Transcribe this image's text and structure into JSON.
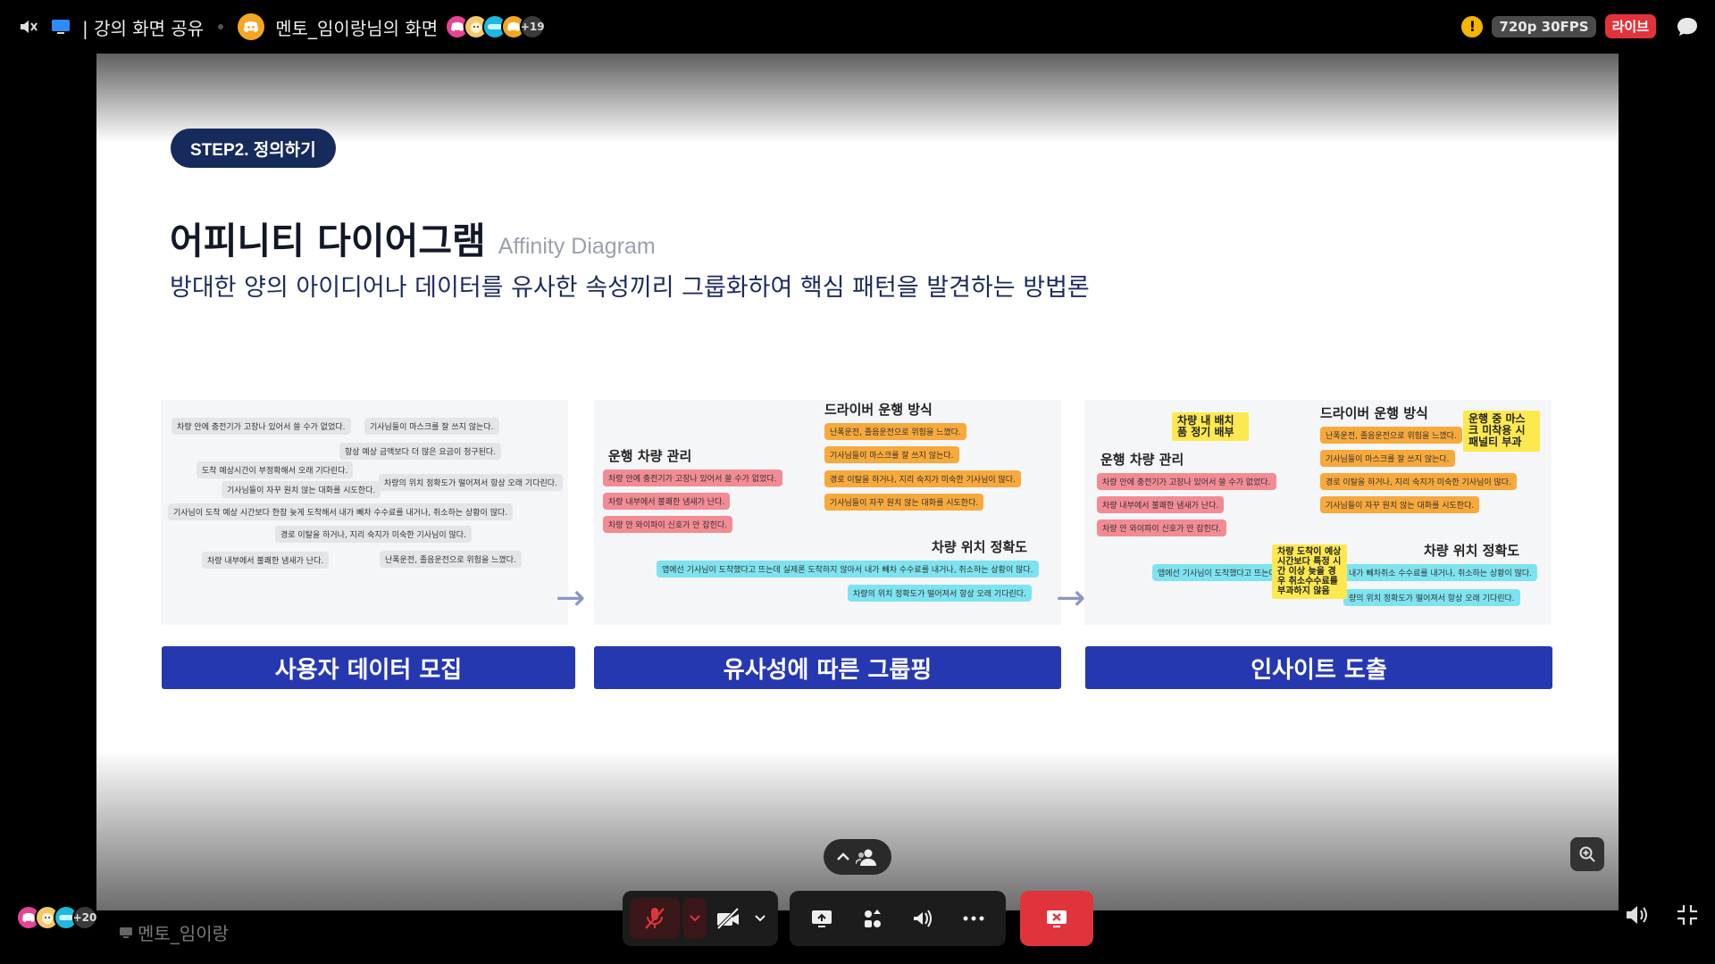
{
  "topbar": {
    "channel_label": "| 강의 화면 공유",
    "stream_title": "멘토_임이랑님의 화면",
    "viewer_more_count": "+19",
    "warning_symbol": "!",
    "quality": "720p 30FPS",
    "live_badge": "라이브"
  },
  "slide": {
    "step_badge": "STEP2. 정의하기",
    "title_ko": "어피니티 다이어그램",
    "title_en": "Affinity Diagram",
    "subtitle": "방대한 양의 아이디어나 데이터를 유사한 속성끼리 그룹화하여 핵심 패턴을 발견하는 방법론",
    "panel1_notes": [
      "차량 안에 충전기가 고장나 있어서 쓸 수가 없었다.",
      "기사님들이 마스크를 잘 쓰지 않는다.",
      "항상 예상 금액보다 더 많은 요금이 청구된다.",
      "도착 예상시간이 부정확해서 오래 기다린다.",
      "차량의 위치 정확도가 떨어져서 항상 오래 기다린다.",
      "기사님들이 자꾸 원치 않는 대화를 시도한다.",
      "기사님이 도착 예상 시간보다 한참 늦게 도착해서 내가 빼차 수수료를 내거나, 취소하는 상황이 많다.",
      "경로 이탈을 하거나, 지리 숙지가 미숙한 기사님이 많다.",
      "차량 내부에서 불쾌한 냄새가 난다.",
      "난폭운전, 졸음운전으로 위험을 느꼈다."
    ],
    "panel2": {
      "group_driver": "드라이버 운행 방식",
      "group_vehicle": "운행 차량 관리",
      "group_location": "차량 위치 정확도",
      "orange_notes": [
        "난폭운전, 졸음운전으로 위험을 느꼈다.",
        "기사님들이 마스크를 잘 쓰지 않는다.",
        "경로 이탈을 하거나, 지리 숙지가 미숙한 기사님이 많다.",
        "기사님들이 자꾸 원치 않는 대화를 시도한다."
      ],
      "pink_notes": [
        "차량 안에 충전기가 고장나 있어서 쓸 수가 없었다.",
        "차량 내부에서 불쾌한 냄새가 난다.",
        "차량 안 와이파이 신호가 안 잡힌다."
      ],
      "cyan_notes": [
        "앱에선 기사님이 도착했다고 뜨는데 실제론 도착하지 않아서 내가 빼차 수수료를 내거나, 취소하는 상황이 많다.",
        "차량의 위치 정확도가 떨어져서 항상 오래 기다린다."
      ]
    },
    "panel3": {
      "group_driver": "드라이버 운행 방식",
      "group_vehicle": "운행 차량 관리",
      "group_location": "차량 위치 정확도",
      "insight_vehicle": "차량 내 배치품 정기 배부",
      "insight_mask": "운행 중 마스크 미착용 시 패널티 부과",
      "insight_eta": "차량 도착이 예상 시간보다 특정 시간 이상 늦을 경우 취소수수료를 부과하지 않음",
      "orange_notes": [
        "난폭운전, 졸음운전으로 위험을 느꼈다.",
        "기사님들이 마스크를 잘 쓰지 않는다.",
        "경로 이탈을 하거나, 지리 숙지가 미숙한 기사님이 많다.",
        "기사님들이 자꾸 원치 않는 대화를 시도한다."
      ],
      "pink_notes": [
        "차량 안에 충전기가 고장나 있어서 쓸 수가 없었다.",
        "차량 내부에서 불쾌한 냄새가 난다.",
        "차량 안 와이파이 신호가 안 잡힌다."
      ],
      "cyan_notes": [
        "앱에선 기사님이 도착했다고 뜨는데 실",
        "내가 빼차취소 수수료를 내거나, 취소하는 상황이 많다.",
        "량의 위치 정확도가 떨어져서 항상 오래 기다린다."
      ]
    },
    "step_labels": [
      "사용자 데이터 모집",
      "유사성에 따른 그룹핑",
      "인사이트 도출"
    ],
    "arrow_glyph": "→"
  },
  "bottom": {
    "participant_more_count": "+20",
    "presenter_name": "멘토_임이랑"
  },
  "colors": {
    "accent_navy": "#162a5c",
    "step_blue": "#2638b0",
    "live_red": "#e2333a",
    "end_call_red": "#e0343c",
    "note_orange": "#f7a93c",
    "note_pink": "#f28b94",
    "note_cyan": "#7ee3f0",
    "note_yellow": "#fde94f"
  },
  "icons": [
    "speaker-muted-icon",
    "screen-share-icon",
    "discord-icon",
    "warning-icon",
    "chat-bubble-icon",
    "chevron-up-icon",
    "people-icon",
    "zoom-in-icon",
    "mic-off-icon",
    "camera-off-icon",
    "share-screen-icon",
    "activities-icon",
    "soundboard-icon",
    "more-icon",
    "leave-call-icon",
    "volume-icon",
    "collapse-icon"
  ]
}
